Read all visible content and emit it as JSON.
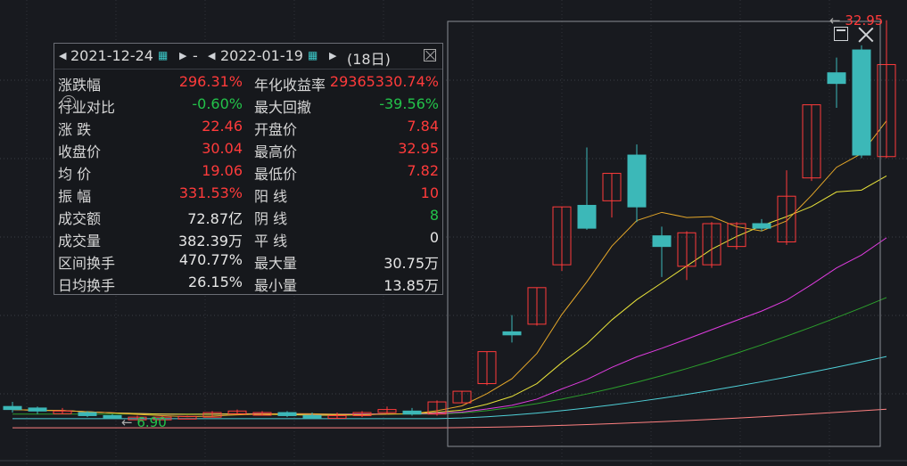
{
  "range_panel": {
    "start_date": "2021-12-24",
    "dash": "-",
    "end_date": "2022-01-19",
    "days": "(18日)",
    "rows": [
      {
        "l1": "涨跌幅",
        "v1": "296.31%",
        "c1": "r",
        "l2": "年化收益率",
        "v2": "29365330.74%",
        "c2": "r"
      },
      {
        "l1": "行业对比",
        "v1": "-0.60%",
        "c1": "g",
        "l2": "最大回撤",
        "v2": "-39.56%",
        "c2": "g"
      },
      {
        "l1": "涨  跌",
        "v1": "22.46",
        "c1": "r",
        "l2": "开盘价",
        "v2": "7.84",
        "c2": "r"
      },
      {
        "l1": "收盘价",
        "v1": "30.04",
        "c1": "r",
        "l2": "最高价",
        "v2": "32.95",
        "c2": "r"
      },
      {
        "l1": "均  价",
        "v1": "19.06",
        "c1": "r",
        "l2": "最低价",
        "v2": "7.82",
        "c2": "r"
      },
      {
        "l1": "振  幅",
        "v1": "331.53%",
        "c1": "r",
        "l2": "阳  线",
        "v2": "10",
        "c2": "r"
      },
      {
        "l1": "成交额",
        "v1": "72.87亿",
        "c1": "w",
        "l2": "阴  线",
        "v2": "8",
        "c2": "g"
      },
      {
        "l1": "成交量",
        "v1": "382.39万",
        "c1": "w",
        "l2": "平  线",
        "v2": "0",
        "c2": "w"
      },
      {
        "l1": "区间换手",
        "v1": "470.77%",
        "c1": "w",
        "l2": "最大量",
        "v2": "30.75万",
        "c2": "w"
      },
      {
        "l1": "日均换手",
        "v1": "26.15%",
        "c1": "w",
        "l2": "最小量",
        "v2": "13.85万",
        "c2": "w"
      }
    ],
    "help_glyph": "?"
  },
  "chart_labels": {
    "high": "32.95",
    "low": "6.90"
  },
  "colors": {
    "up": "#ff3b3b",
    "down": "#3cb8b8",
    "ma5": "#e6a829",
    "ma10": "#e8e23a",
    "ma20": "#e03ce0",
    "ma30": "#2ca02c",
    "ma60": "#4fd0d8",
    "ma120": "#ff8080"
  },
  "chart_data": {
    "type": "candlestick",
    "candles": [
      {
        "o": 7.6,
        "c": 7.4,
        "h": 7.9,
        "l": 7.2
      },
      {
        "o": 7.5,
        "c": 7.3,
        "h": 7.6,
        "l": 7.1
      },
      {
        "o": 7.3,
        "c": 7.3,
        "h": 7.5,
        "l": 7.1
      },
      {
        "o": 7.2,
        "c": 7.0,
        "h": 7.3,
        "l": 6.9
      },
      {
        "o": 7.0,
        "c": 6.9,
        "h": 7.1,
        "l": 6.9
      },
      {
        "o": 6.9,
        "c": 6.9,
        "h": 7.0,
        "l": 6.8
      },
      {
        "o": 6.9,
        "c": 6.9,
        "h": 7.0,
        "l": 6.8
      },
      {
        "o": 6.95,
        "c": 6.95,
        "h": 7.0,
        "l": 6.9
      },
      {
        "o": 6.9,
        "c": 7.2,
        "h": 7.3,
        "l": 6.9
      },
      {
        "o": 7.2,
        "c": 7.3,
        "h": 7.4,
        "l": 7.1
      },
      {
        "o": 7.1,
        "c": 7.2,
        "h": 7.3,
        "l": 7.0
      },
      {
        "o": 7.2,
        "c": 7.0,
        "h": 7.3,
        "l": 6.9
      },
      {
        "o": 7.0,
        "c": 6.9,
        "h": 7.2,
        "l": 6.8
      },
      {
        "o": 6.9,
        "c": 7.0,
        "h": 7.2,
        "l": 6.8
      },
      {
        "o": 7.0,
        "c": 7.2,
        "h": 7.3,
        "l": 6.9
      },
      {
        "o": 7.2,
        "c": 7.4,
        "h": 7.6,
        "l": 7.1
      },
      {
        "o": 7.3,
        "c": 7.1,
        "h": 7.5,
        "l": 7.0
      },
      {
        "o": 7.1,
        "c": 7.9,
        "h": 8.0,
        "l": 7.0
      },
      {
        "o": 7.84,
        "c": 8.6,
        "h": 8.6,
        "l": 7.82
      },
      {
        "o": 9.1,
        "c": 11.2,
        "h": 11.2,
        "l": 9.0
      },
      {
        "o": 12.5,
        "c": 12.3,
        "h": 13.6,
        "l": 11.8
      },
      {
        "o": 13.0,
        "c": 15.4,
        "h": 15.4,
        "l": 12.9
      },
      {
        "o": 16.9,
        "c": 20.7,
        "h": 20.7,
        "l": 16.5
      },
      {
        "o": 20.8,
        "c": 19.3,
        "h": 24.6,
        "l": 19.2
      },
      {
        "o": 21.1,
        "c": 22.9,
        "h": 22.9,
        "l": 20.0
      },
      {
        "o": 24.1,
        "c": 20.7,
        "h": 24.8,
        "l": 19.7
      },
      {
        "o": 18.8,
        "c": 18.1,
        "h": 19.4,
        "l": 16.1
      },
      {
        "o": 16.8,
        "c": 19.0,
        "h": 19.1,
        "l": 15.9
      },
      {
        "o": 16.9,
        "c": 19.6,
        "h": 19.7,
        "l": 16.7
      },
      {
        "o": 18.1,
        "c": 19.6,
        "h": 19.7,
        "l": 17.9
      },
      {
        "o": 19.6,
        "c": 19.3,
        "h": 19.9,
        "l": 19.1
      },
      {
        "o": 18.4,
        "c": 21.4,
        "h": 23.1,
        "l": 18.2
      },
      {
        "o": 22.6,
        "c": 27.4,
        "h": 27.4,
        "l": 22.4
      },
      {
        "o": 29.5,
        "c": 28.8,
        "h": 30.5,
        "l": 27.2
      },
      {
        "o": 31.0,
        "c": 24.1,
        "h": 31.3,
        "l": 23.9
      },
      {
        "o": 24.0,
        "c": 30.04,
        "h": 32.95,
        "l": 23.9
      }
    ]
  }
}
